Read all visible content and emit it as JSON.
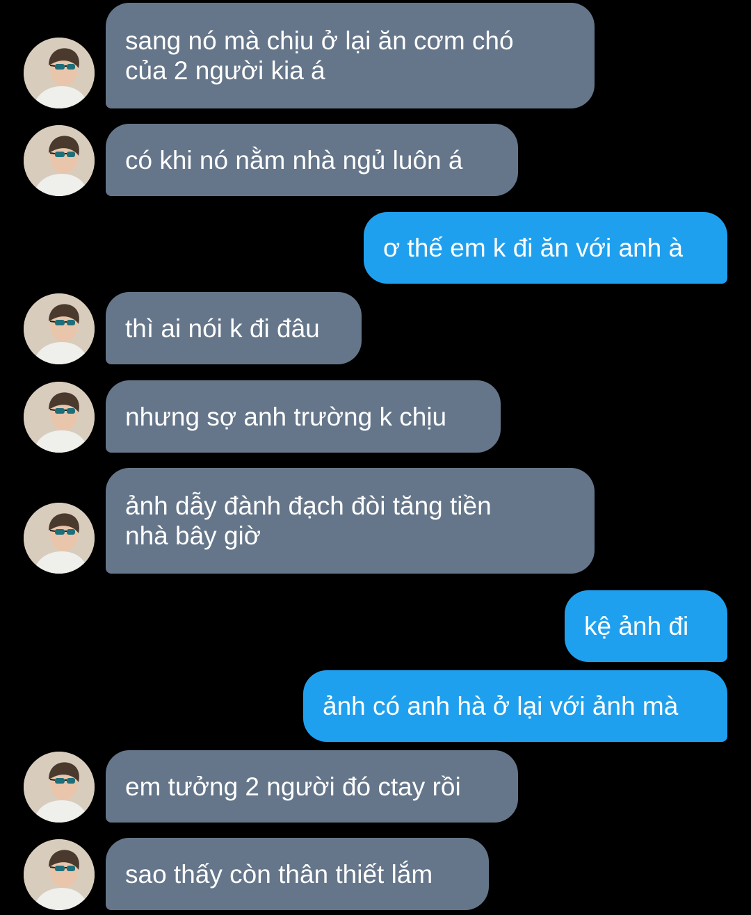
{
  "conversation": {
    "messages": [
      {
        "sender": "other",
        "text": "sang nó mà chịu ở lại ăn cơm chó\ncủa 2 người kia á"
      },
      {
        "sender": "other",
        "text": "có khi nó nằm nhà ngủ luôn á"
      },
      {
        "sender": "me",
        "text": "ơ thế em k đi ăn với anh à"
      },
      {
        "sender": "other",
        "text": "thì ai nói k đi đâu"
      },
      {
        "sender": "other",
        "text": "nhưng sợ anh trường k chịu"
      },
      {
        "sender": "other",
        "text": "ảnh dẫy đành đạch đòi tăng tiền\nnhà bây giờ"
      },
      {
        "sender": "me",
        "text": "kệ ảnh đi"
      },
      {
        "sender": "me",
        "text": "ảnh có anh hà ở lại với ảnh mà"
      },
      {
        "sender": "other",
        "text": "em tưởng 2 người đó ctay rồi"
      },
      {
        "sender": "other",
        "text": "sao thấy còn thân thiết lắm"
      }
    ]
  },
  "colors": {
    "background": "#000000",
    "incoming_bubble": "#65768a",
    "outgoing_bubble": "#1fa0ef",
    "text": "#ffffff"
  },
  "icons": {
    "avatar": "avatar-photo-person-with-sunglasses"
  }
}
